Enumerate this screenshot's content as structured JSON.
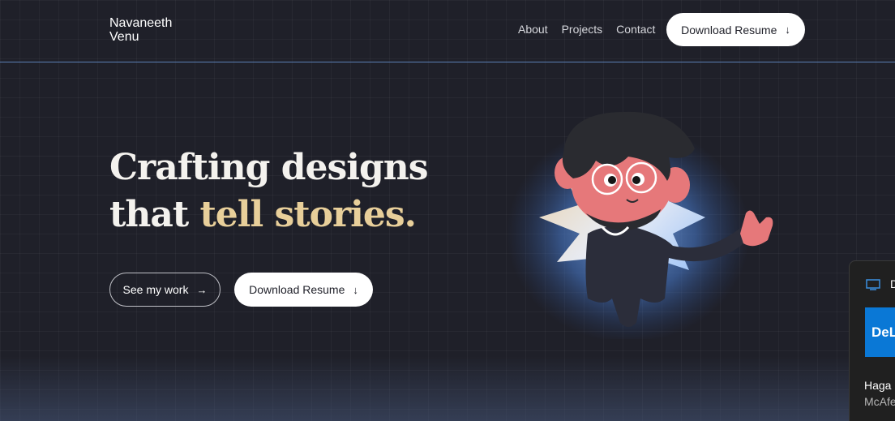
{
  "header": {
    "brand_line1": "Navaneeth",
    "brand_line2": "Venu",
    "nav": [
      "About",
      "Projects",
      "Contact"
    ],
    "download_label": "Download Resume",
    "download_arrow": "↓"
  },
  "hero": {
    "title_line1": "Crafting designs",
    "title_line2_plain": "that ",
    "title_line2_accent": "tell stories.",
    "see_work_label": "See my work",
    "see_work_arrow": "→",
    "download_label": "Download Resume",
    "download_arrow": "↓"
  },
  "popup": {
    "title": "D",
    "logo_text": "DeL",
    "line1": "Haga",
    "line2": "McAfe"
  },
  "colors": {
    "background": "#1f2029",
    "accent_text": "#e8cf9a",
    "header_border": "#5a7fb5",
    "popup_logo": "#0a78d6"
  },
  "icons": {
    "illustration": "avatar-character-waving",
    "popup_icon": "monitor-icon"
  }
}
